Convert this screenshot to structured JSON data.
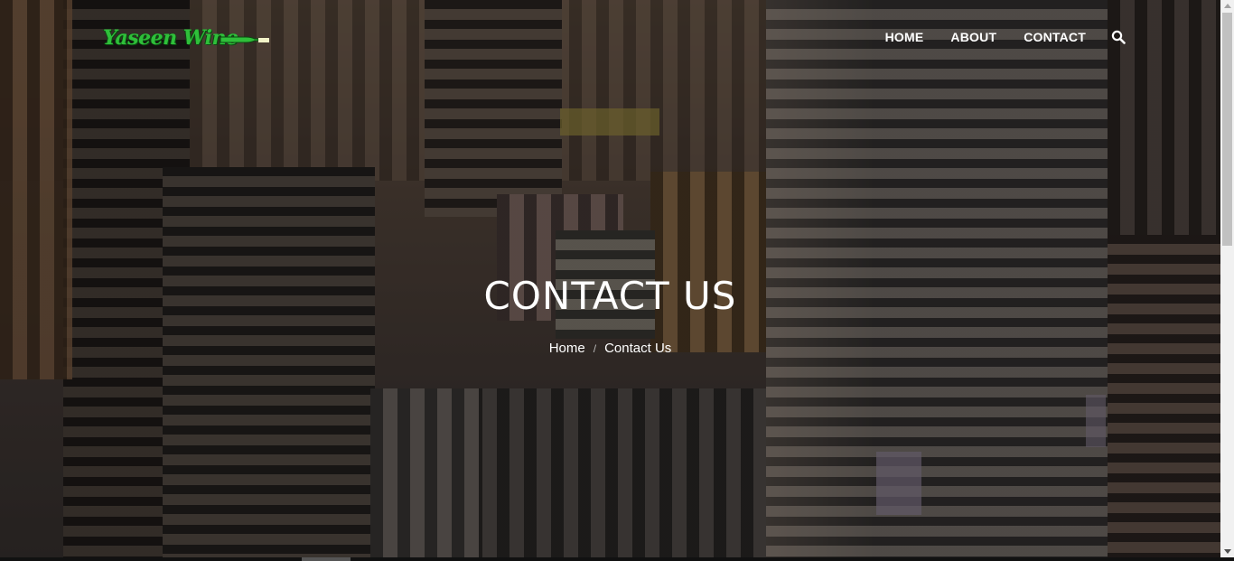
{
  "logo": {
    "text": "Yaseen Wine"
  },
  "nav": {
    "items": [
      {
        "label": "HOME"
      },
      {
        "label": "ABOUT"
      },
      {
        "label": "CONTACT"
      }
    ],
    "search_icon": "search-icon"
  },
  "hero": {
    "title": "CONTACT US",
    "breadcrumb": {
      "home": "Home",
      "separator": "/",
      "current": "Contact Us"
    }
  },
  "colors": {
    "logo_green": "#2fbf3a",
    "nav_text": "#ffffff",
    "overlay": "#141010"
  }
}
